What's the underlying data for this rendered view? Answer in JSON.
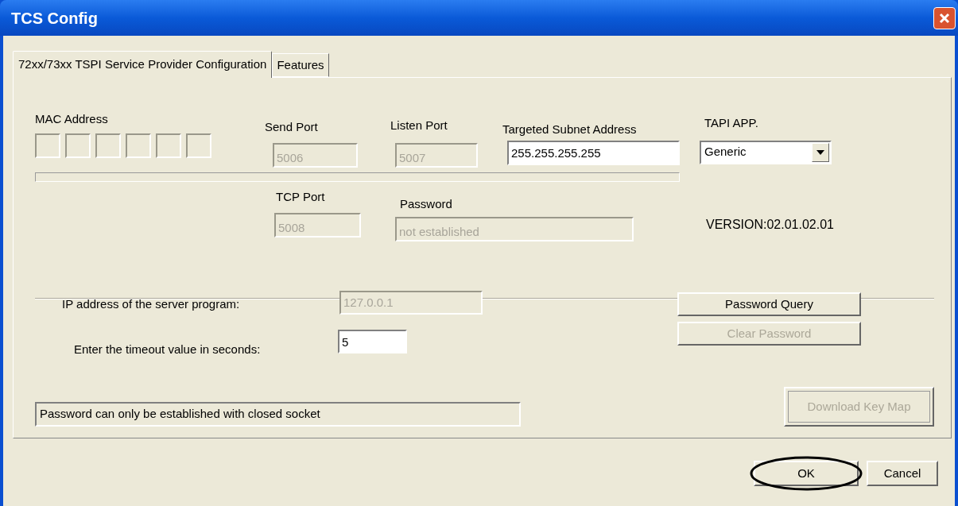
{
  "window": {
    "title": "TCS Config"
  },
  "tabs": [
    {
      "label": "72xx/73xx TSPI Service Provider Configuration",
      "selected": true
    },
    {
      "label": "Features",
      "selected": false
    }
  ],
  "mac_address": {
    "label": "MAC Address",
    "octet_fields": [
      {
        "disabled": true
      },
      {
        "disabled": true
      },
      {
        "disabled": true
      },
      {
        "disabled": true
      },
      {
        "disabled": true
      },
      {
        "disabled": true
      }
    ]
  },
  "send_port": {
    "label": "Send Port",
    "value": "5006",
    "disabled": true
  },
  "listen_port": {
    "label": "Listen Port",
    "value": "5007",
    "disabled": true
  },
  "subnet": {
    "label": "Targeted Subnet Address",
    "value": "255.255.255.255",
    "disabled": false
  },
  "tapi_app": {
    "label": "TAPI APP.",
    "value": "Generic"
  },
  "progress_bar": {
    "level": 0
  },
  "tcp_port": {
    "label": "TCP Port",
    "value": "5008",
    "disabled": true
  },
  "password": {
    "label": "Password",
    "value": "not established",
    "disabled": true
  },
  "version": "VERSION:02.01.02.01",
  "server_ip": {
    "label": "IP address of the server program:",
    "value": "127.0.0.1",
    "disabled": true
  },
  "timeout": {
    "label": "Enter the timeout value in seconds:",
    "value": "5",
    "disabled": false
  },
  "side_buttons": [
    {
      "label": "Password Query",
      "disabled": false
    },
    {
      "label": "Clear Password",
      "disabled": true
    }
  ],
  "status_text": "Password can only be established with closed socket",
  "download_button": {
    "label": "Download Key Map",
    "disabled": true
  },
  "footer_buttons": [
    {
      "label": "OK",
      "highlighted": true
    },
    {
      "label": "Cancel",
      "highlighted": false
    }
  ]
}
